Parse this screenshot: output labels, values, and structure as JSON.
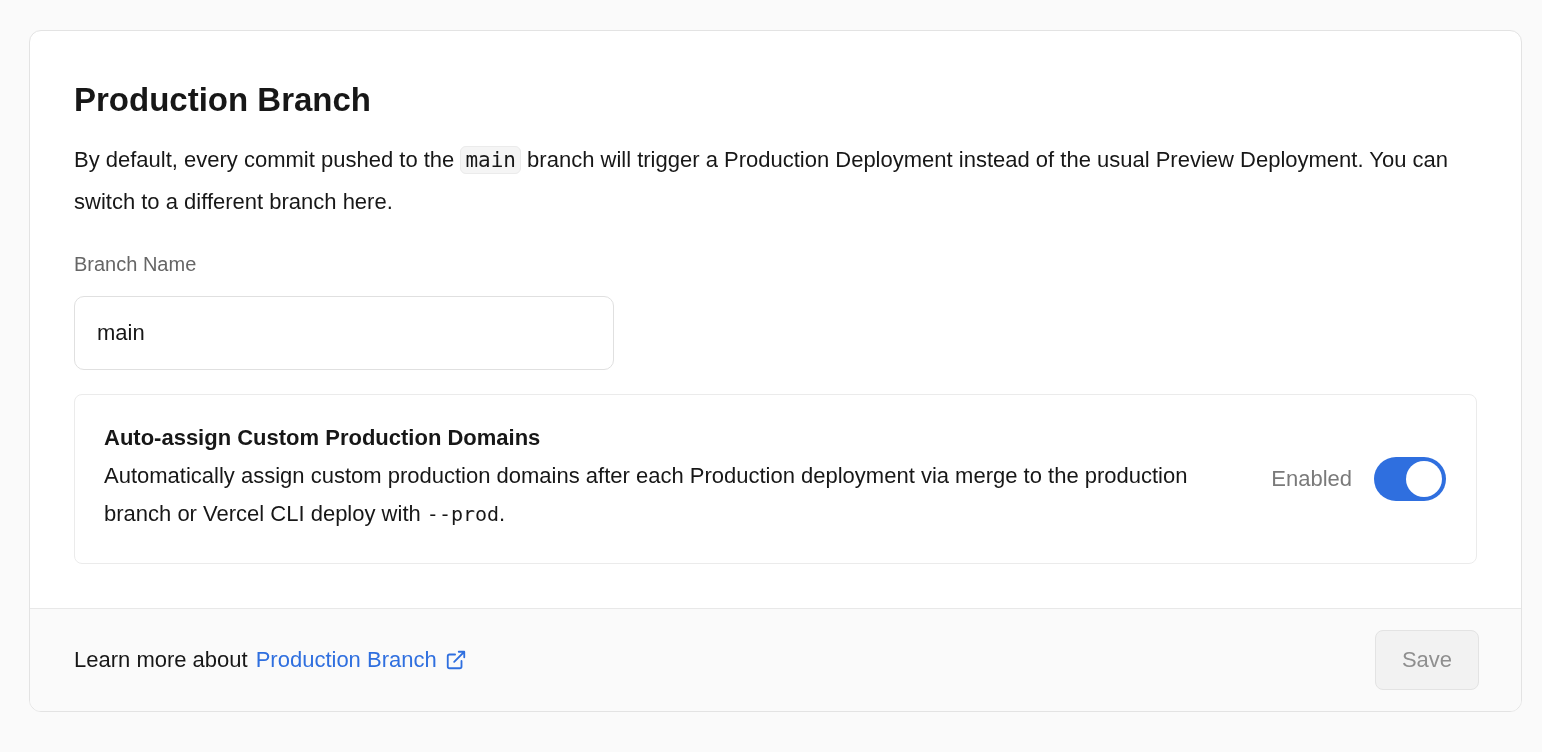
{
  "section": {
    "title": "Production Branch",
    "description": [
      {
        "kind": "text",
        "text": "By default, every commit pushed to the "
      },
      {
        "kind": "code",
        "text": "main"
      },
      {
        "kind": "text",
        "text": " branch will trigger a Production Deployment instead of the usual Preview Deployment. You can switch to a different branch here."
      }
    ]
  },
  "branch_field": {
    "label": "Branch Name",
    "value": "main"
  },
  "auto_assign": {
    "title": "Auto-assign Custom Production Domains",
    "description": [
      {
        "kind": "text",
        "text": "Automatically assign custom production domains after each Production deployment via merge to the production branch or Vercel CLI deploy with "
      },
      {
        "kind": "code",
        "text": "--prod"
      },
      {
        "kind": "text",
        "text": "."
      }
    ],
    "status": "Enabled",
    "on": true
  },
  "footer": {
    "text": "Learn more about",
    "link": "Production Branch",
    "save_button": {
      "label": "Save",
      "disabled": true
    }
  }
}
